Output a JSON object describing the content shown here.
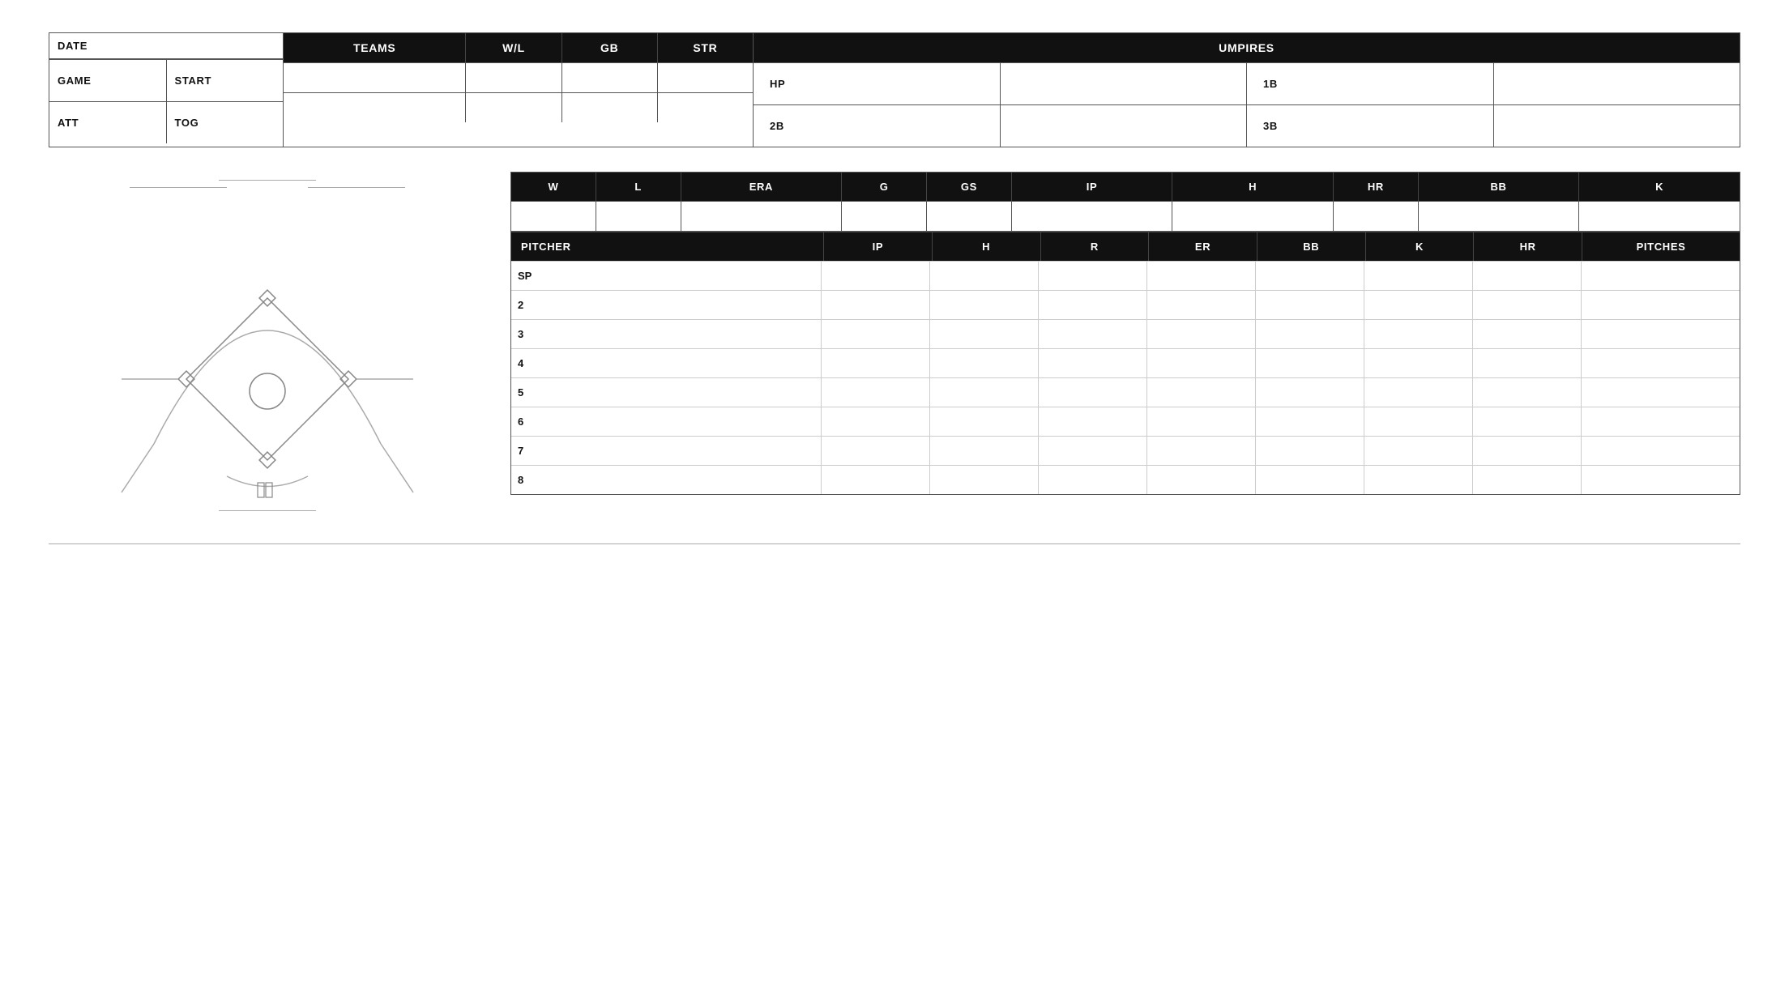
{
  "top": {
    "info": {
      "date_label": "DATE",
      "game_label": "GAME",
      "start_label": "START",
      "att_label": "ATT",
      "tog_label": "TOG"
    },
    "teams_headers": [
      "TEAMS",
      "W/L",
      "GB",
      "STR"
    ],
    "umpires_header": "UMPIRES",
    "umpires": [
      {
        "pos1": "HP",
        "pos2": "1B"
      },
      {
        "pos1": "2B",
        "pos2": "3B"
      }
    ]
  },
  "record_table": {
    "headers": [
      "W",
      "L",
      "ERA",
      "G",
      "GS",
      "IP",
      "H",
      "HR",
      "BB",
      "K"
    ]
  },
  "pitcher_table": {
    "header": "PITCHER",
    "columns": [
      "IP",
      "H",
      "R",
      "ER",
      "BB",
      "K",
      "HR",
      "PITCHES"
    ],
    "rows": [
      {
        "num": "SP"
      },
      {
        "num": "2"
      },
      {
        "num": "3"
      },
      {
        "num": "4"
      },
      {
        "num": "5"
      },
      {
        "num": "6"
      },
      {
        "num": "7"
      },
      {
        "num": "8"
      }
    ]
  },
  "colors": {
    "header_bg": "#111111",
    "header_text": "#ffffff",
    "border": "#555555",
    "light_border": "#cccccc"
  }
}
